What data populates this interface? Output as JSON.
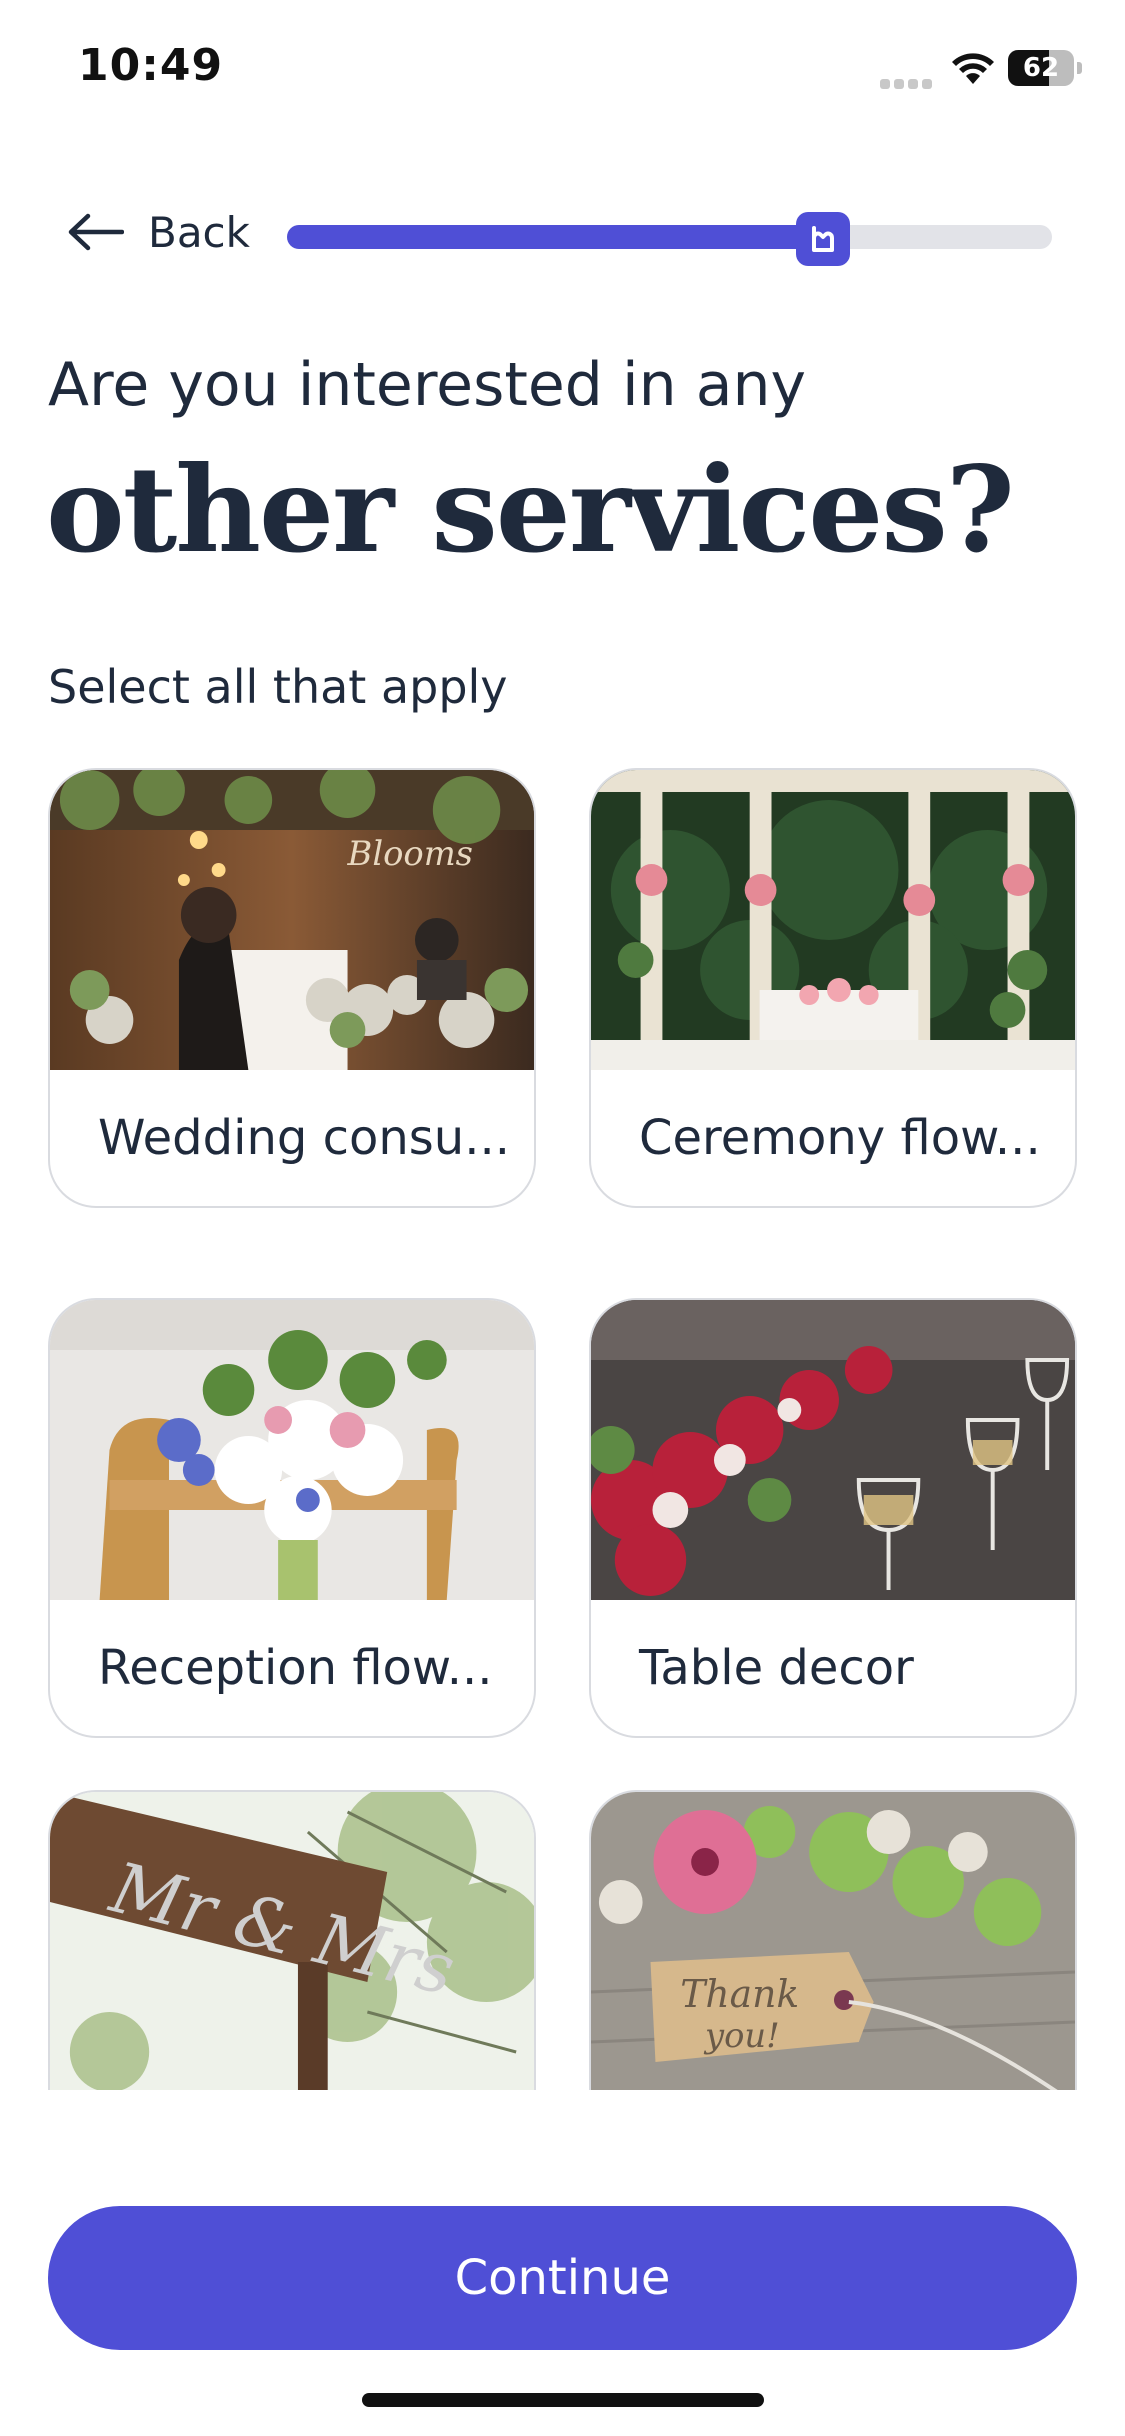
{
  "status_bar": {
    "time": "10:49",
    "battery_level": "62",
    "icons": [
      "signal-icon",
      "wifi-icon",
      "battery-icon"
    ]
  },
  "nav": {
    "back_label": "Back",
    "back_icon": "arrow-left-icon",
    "progress_fraction": 0.7,
    "progress_thumb_icon": "brand-logo-icon"
  },
  "heading": {
    "line1": "Are you interested in any",
    "line2": "other services?"
  },
  "subtitle": "Select all that apply",
  "services": [
    {
      "label": "Wedding consu...",
      "image": "florist-shop-photo"
    },
    {
      "label": "Ceremony flow...",
      "image": "gazebo-ceremony-photo"
    },
    {
      "label": "Reception flow...",
      "image": "chair-bouquet-photo"
    },
    {
      "label": "Table decor",
      "image": "table-flowers-glasses-photo"
    },
    {
      "label": "",
      "image": "mr-mrs-sign-photo"
    },
    {
      "label": "",
      "image": "thank-you-tag-flowers-photo"
    }
  ],
  "continue_label": "Continue",
  "colors": {
    "accent": "#4f4fd6",
    "text": "#1f2a3c",
    "track": "#e2e3e8",
    "card_border": "#d9dbe0"
  }
}
